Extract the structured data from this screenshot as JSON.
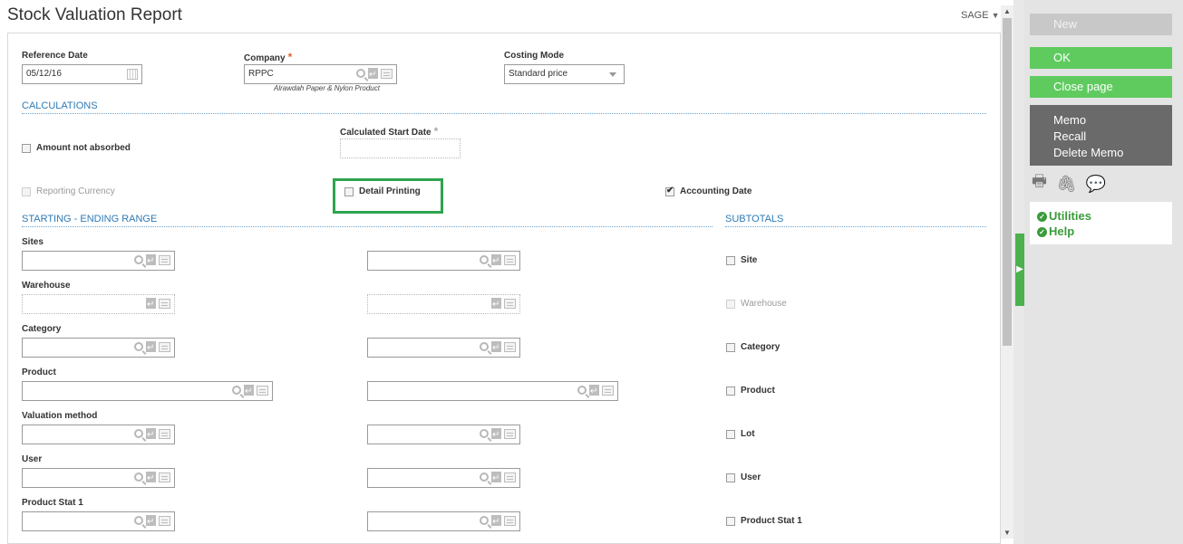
{
  "header": {
    "title": "Stock Valuation Report",
    "menu": "SAGE"
  },
  "form": {
    "reference_date": {
      "label": "Reference Date",
      "value": "05/12/16"
    },
    "company": {
      "label": "Company",
      "value": "RPPC",
      "description": "Alrawdah Paper & Nylon Product"
    },
    "costing_mode": {
      "label": "Costing Mode",
      "value": "Standard price"
    },
    "calculations": {
      "title": "CALCULATIONS",
      "amount_not_absorbed": "Amount not absorbed",
      "calculated_start_date": "Calculated Start Date",
      "reporting_currency": "Reporting Currency",
      "detail_printing": "Detail Printing",
      "accounting_date": "Accounting Date"
    },
    "range": {
      "title": "STARTING - ENDING RANGE",
      "rows": [
        "Sites",
        "Warehouse",
        "Category",
        "Product",
        "Valuation method",
        "User",
        "Product Stat 1"
      ]
    },
    "subtotals": {
      "title": "SUBTOTALS",
      "items": [
        "Site",
        "Warehouse",
        "Category",
        "Product",
        "Lot",
        "User",
        "Product Stat 1"
      ]
    }
  },
  "sidebar": {
    "new": "New",
    "ok": "OK",
    "close_page": "Close page",
    "memo": [
      "Memo",
      "Recall",
      "Delete Memo"
    ],
    "icons": [
      "print-icon",
      "attachment-icon",
      "comment-icon"
    ],
    "links": [
      "Utilities",
      "Help"
    ]
  },
  "colors": {
    "green": "#5fcb5f",
    "section_blue": "#2d7ab5",
    "highlight": "#2ea44f"
  }
}
